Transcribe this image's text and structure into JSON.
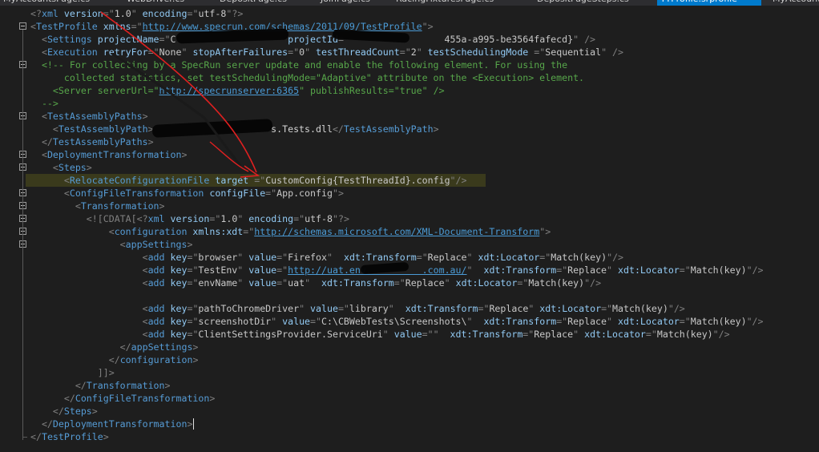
{
  "tabs": [
    {
      "label": "MyAccountsPage.cs",
      "active": false
    },
    {
      "label": "WebDriver.cs",
      "active": false
    },
    {
      "label": "DepositPage.cs",
      "active": false
    },
    {
      "label": "JoinPage.cs",
      "active": false
    },
    {
      "label": "RacingFixturesPage.cs",
      "active": false
    },
    {
      "label": "DepositPageSteps.cs",
      "active": false
    },
    {
      "label": "TTProfile.srprofile",
      "active": true
    },
    {
      "label": "MyAccount",
      "active": false
    }
  ],
  "tab_icons": [
    "pin-icon",
    "close-icon"
  ],
  "code_lines": [
    {
      "indent": 0,
      "parts": [
        [
          "d",
          "<?"
        ],
        [
          "t",
          "xml"
        ],
        [
          "a",
          " version"
        ],
        [
          "d",
          "="
        ],
        [
          "d",
          "\""
        ],
        [
          "v",
          "1.0"
        ],
        [
          "d",
          "\""
        ],
        [
          "a",
          " encoding"
        ],
        [
          "d",
          "="
        ],
        [
          "d",
          "\""
        ],
        [
          "v",
          "utf-8"
        ],
        [
          "d",
          "\""
        ],
        [
          "d",
          "?>"
        ]
      ]
    },
    {
      "indent": 0,
      "parts": [
        [
          "d",
          "<"
        ],
        [
          "t",
          "TestProfile"
        ],
        [
          "a",
          " xmlns"
        ],
        [
          "d",
          "="
        ],
        [
          "d",
          "\""
        ],
        [
          "u",
          "http://www.specrun.com/schemas/2011/09/TestProfile"
        ],
        [
          "d",
          "\""
        ],
        [
          "d",
          ">"
        ]
      ]
    },
    {
      "indent": 1,
      "parts": [
        [
          "d",
          "<"
        ],
        [
          "t",
          "Settings"
        ],
        [
          "a",
          " projectName"
        ],
        [
          "d",
          "="
        ],
        [
          "d",
          "\""
        ],
        [
          "v",
          "C                   "
        ],
        [
          "a",
          " projectId"
        ],
        [
          "d",
          "="
        ],
        [
          "v",
          "                  455a-a995-be3564fafecd}"
        ],
        [
          "d",
          "\""
        ],
        [
          "d",
          " />"
        ]
      ]
    },
    {
      "indent": 1,
      "parts": [
        [
          "d",
          "<"
        ],
        [
          "t",
          "Execution"
        ],
        [
          "a",
          " retryFor"
        ],
        [
          "d",
          "="
        ],
        [
          "d",
          "\""
        ],
        [
          "v",
          "None"
        ],
        [
          "d",
          "\""
        ],
        [
          "a",
          " stopAfterFailures"
        ],
        [
          "d",
          "="
        ],
        [
          "d",
          "\""
        ],
        [
          "v",
          "0"
        ],
        [
          "d",
          "\""
        ],
        [
          "a",
          " testThreadCount"
        ],
        [
          "d",
          "="
        ],
        [
          "d",
          "\""
        ],
        [
          "v",
          "2"
        ],
        [
          "d",
          "\""
        ],
        [
          "a",
          " testSchedulingMode"
        ],
        [
          "d",
          " ="
        ],
        [
          "d",
          "\""
        ],
        [
          "v",
          "Sequential"
        ],
        [
          "d",
          "\""
        ],
        [
          "d",
          " />"
        ]
      ]
    },
    {
      "indent": 1,
      "parts": [
        [
          "c",
          "<!-- For collecting by a SpecRun server update and enable the following element. For using the"
        ]
      ]
    },
    {
      "indent": 0,
      "parts": [
        [
          "c",
          "      collected statistics, set testSchedulingMode=\"Adaptive\" attribute on the <Execution> element."
        ]
      ]
    },
    {
      "indent": 0,
      "parts": [
        [
          "c",
          "    <Server serverUrl=\""
        ],
        [
          "u",
          "http://specrunserver:6365"
        ],
        [
          "c",
          "\" publishResults=\"true\" />"
        ]
      ]
    },
    {
      "indent": 1,
      "parts": [
        [
          "c",
          "-->"
        ]
      ]
    },
    {
      "indent": 1,
      "parts": [
        [
          "d",
          "<"
        ],
        [
          "t",
          "TestAssemblyPaths"
        ],
        [
          "d",
          ">"
        ]
      ]
    },
    {
      "indent": 2,
      "parts": [
        [
          "d",
          "<"
        ],
        [
          "t",
          "TestAssemblyPath"
        ],
        [
          "d",
          ">"
        ],
        [
          "p",
          "           "
        ],
        [
          "p",
          "          s.Tests.dll"
        ],
        [
          "d",
          "</"
        ],
        [
          "t",
          "TestAssemblyPath"
        ],
        [
          "d",
          ">"
        ]
      ]
    },
    {
      "indent": 1,
      "parts": [
        [
          "d",
          "</"
        ],
        [
          "t",
          "TestAssemblyPaths"
        ],
        [
          "d",
          ">"
        ]
      ]
    },
    {
      "indent": 1,
      "parts": [
        [
          "d",
          "<"
        ],
        [
          "t",
          "DeploymentTransformation"
        ],
        [
          "d",
          ">"
        ]
      ]
    },
    {
      "indent": 2,
      "parts": [
        [
          "d",
          "<"
        ],
        [
          "t",
          "Steps"
        ],
        [
          "d",
          ">"
        ]
      ]
    },
    {
      "indent": 3,
      "parts": [
        [
          "d",
          "<"
        ],
        [
          "t",
          "RelocateConfigurationFile"
        ],
        [
          "a",
          " target"
        ],
        [
          "d",
          " ="
        ],
        [
          "d",
          "\""
        ],
        [
          "v",
          "CustomConfig{TestThreadId}.config"
        ],
        [
          "d",
          "\""
        ],
        [
          "d",
          "/>"
        ]
      ]
    },
    {
      "indent": 3,
      "parts": [
        [
          "d",
          "<"
        ],
        [
          "t",
          "ConfigFileTransformation"
        ],
        [
          "a",
          " configFile"
        ],
        [
          "d",
          "="
        ],
        [
          "d",
          "\""
        ],
        [
          "v",
          "App.config"
        ],
        [
          "d",
          "\""
        ],
        [
          "d",
          ">"
        ]
      ]
    },
    {
      "indent": 4,
      "parts": [
        [
          "d",
          "<"
        ],
        [
          "t",
          "Transformation"
        ],
        [
          "d",
          ">"
        ]
      ]
    },
    {
      "indent": 5,
      "parts": [
        [
          "d",
          "<![CDATA["
        ],
        [
          "d",
          "<?"
        ],
        [
          "t",
          "xml"
        ],
        [
          "a",
          " version"
        ],
        [
          "d",
          "="
        ],
        [
          "d",
          "\""
        ],
        [
          "v",
          "1.0"
        ],
        [
          "d",
          "\""
        ],
        [
          "a",
          " encoding"
        ],
        [
          "d",
          "="
        ],
        [
          "d",
          "\""
        ],
        [
          "v",
          "utf-8"
        ],
        [
          "d",
          "\""
        ],
        [
          "d",
          "?>"
        ]
      ]
    },
    {
      "indent": 7,
      "parts": [
        [
          "d",
          "<"
        ],
        [
          "t",
          "configuration"
        ],
        [
          "a",
          " xmlns:xdt"
        ],
        [
          "d",
          "="
        ],
        [
          "d",
          "\""
        ],
        [
          "u",
          "http://schemas.microsoft.com/XML-Document-Transform"
        ],
        [
          "d",
          "\""
        ],
        [
          "d",
          ">"
        ]
      ]
    },
    {
      "indent": 8,
      "parts": [
        [
          "d",
          "<"
        ],
        [
          "t",
          "appSettings"
        ],
        [
          "d",
          ">"
        ]
      ]
    },
    {
      "indent": 10,
      "parts": [
        [
          "d",
          "<"
        ],
        [
          "t",
          "add"
        ],
        [
          "a",
          " key"
        ],
        [
          "d",
          "="
        ],
        [
          "d",
          "\""
        ],
        [
          "v",
          "browser"
        ],
        [
          "d",
          "\""
        ],
        [
          "a",
          " value"
        ],
        [
          "d",
          "="
        ],
        [
          "d",
          "\""
        ],
        [
          "v",
          "Firefox"
        ],
        [
          "d",
          "\""
        ],
        [
          "a",
          "  xdt:Transform"
        ],
        [
          "d",
          "="
        ],
        [
          "d",
          "\""
        ],
        [
          "v",
          "Replace"
        ],
        [
          "d",
          "\""
        ],
        [
          "a",
          " xdt:Locator"
        ],
        [
          "d",
          "="
        ],
        [
          "d",
          "\""
        ],
        [
          "v",
          "Match(key)"
        ],
        [
          "d",
          "\""
        ],
        [
          "d",
          "/>"
        ]
      ]
    },
    {
      "indent": 10,
      "parts": [
        [
          "d",
          "<"
        ],
        [
          "t",
          "add"
        ],
        [
          "a",
          " key"
        ],
        [
          "d",
          "="
        ],
        [
          "d",
          "\""
        ],
        [
          "v",
          "TestEnv"
        ],
        [
          "d",
          "\""
        ],
        [
          "a",
          " value"
        ],
        [
          "d",
          "="
        ],
        [
          "d",
          "\""
        ],
        [
          "u",
          "http://uat.env.         .com.au/"
        ],
        [
          "d",
          "\""
        ],
        [
          "a",
          "  xdt:Transform"
        ],
        [
          "d",
          "="
        ],
        [
          "d",
          "\""
        ],
        [
          "v",
          "Replace"
        ],
        [
          "d",
          "\""
        ],
        [
          "a",
          " xdt:Locator"
        ],
        [
          "d",
          "="
        ],
        [
          "d",
          "\""
        ],
        [
          "v",
          "Match(key)"
        ],
        [
          "d",
          "\""
        ],
        [
          "d",
          "/>"
        ]
      ]
    },
    {
      "indent": 10,
      "parts": [
        [
          "d",
          "<"
        ],
        [
          "t",
          "add"
        ],
        [
          "a",
          " key"
        ],
        [
          "d",
          "="
        ],
        [
          "d",
          "\""
        ],
        [
          "v",
          "envName"
        ],
        [
          "d",
          "\""
        ],
        [
          "a",
          " value"
        ],
        [
          "d",
          "="
        ],
        [
          "d",
          "\""
        ],
        [
          "v",
          "uat"
        ],
        [
          "d",
          "\""
        ],
        [
          "a",
          "  xdt:Transform"
        ],
        [
          "d",
          "="
        ],
        [
          "d",
          "\""
        ],
        [
          "v",
          "Replace"
        ],
        [
          "d",
          "\""
        ],
        [
          "a",
          " xdt:Locator"
        ],
        [
          "d",
          "="
        ],
        [
          "d",
          "\""
        ],
        [
          "v",
          "Match(key)"
        ],
        [
          "d",
          "\""
        ],
        [
          "d",
          "/>"
        ]
      ]
    },
    {
      "indent": 0,
      "parts": []
    },
    {
      "indent": 10,
      "parts": [
        [
          "d",
          "<"
        ],
        [
          "t",
          "add"
        ],
        [
          "a",
          " key"
        ],
        [
          "d",
          "="
        ],
        [
          "d",
          "\""
        ],
        [
          "v",
          "pathToChromeDriver"
        ],
        [
          "d",
          "\""
        ],
        [
          "a",
          " value"
        ],
        [
          "d",
          "="
        ],
        [
          "d",
          "\""
        ],
        [
          "v",
          "library"
        ],
        [
          "d",
          "\""
        ],
        [
          "a",
          "  xdt:Transform"
        ],
        [
          "d",
          "="
        ],
        [
          "d",
          "\""
        ],
        [
          "v",
          "Replace"
        ],
        [
          "d",
          "\""
        ],
        [
          "a",
          " xdt:Locator"
        ],
        [
          "d",
          "="
        ],
        [
          "d",
          "\""
        ],
        [
          "v",
          "Match(key)"
        ],
        [
          "d",
          "\""
        ],
        [
          "d",
          "/>"
        ]
      ]
    },
    {
      "indent": 10,
      "parts": [
        [
          "d",
          "<"
        ],
        [
          "t",
          "add"
        ],
        [
          "a",
          " key"
        ],
        [
          "d",
          "="
        ],
        [
          "d",
          "\""
        ],
        [
          "v",
          "screenshotDir"
        ],
        [
          "d",
          "\""
        ],
        [
          "a",
          " value"
        ],
        [
          "d",
          "="
        ],
        [
          "d",
          "\""
        ],
        [
          "v",
          "C:\\CBWebTests\\Screenshots\\"
        ],
        [
          "d",
          "\""
        ],
        [
          "a",
          "  xdt:Transform"
        ],
        [
          "d",
          "="
        ],
        [
          "d",
          "\""
        ],
        [
          "v",
          "Replace"
        ],
        [
          "d",
          "\""
        ],
        [
          "a",
          " xdt:Locator"
        ],
        [
          "d",
          "="
        ],
        [
          "d",
          "\""
        ],
        [
          "v",
          "Match(key)"
        ],
        [
          "d",
          "\""
        ],
        [
          "d",
          "/>"
        ]
      ]
    },
    {
      "indent": 10,
      "parts": [
        [
          "d",
          "<"
        ],
        [
          "t",
          "add"
        ],
        [
          "a",
          " key"
        ],
        [
          "d",
          "="
        ],
        [
          "d",
          "\""
        ],
        [
          "v",
          "ClientSettingsProvider.ServiceUri"
        ],
        [
          "d",
          "\""
        ],
        [
          "a",
          " value"
        ],
        [
          "d",
          "="
        ],
        [
          "d",
          "\"\""
        ],
        [
          "a",
          "  xdt:Transform"
        ],
        [
          "d",
          "="
        ],
        [
          "d",
          "\""
        ],
        [
          "v",
          "Replace"
        ],
        [
          "d",
          "\""
        ],
        [
          "a",
          " xdt:Locator"
        ],
        [
          "d",
          "="
        ],
        [
          "d",
          "\""
        ],
        [
          "v",
          "Match(key)"
        ],
        [
          "d",
          "\""
        ],
        [
          "d",
          "/>"
        ]
      ]
    },
    {
      "indent": 8,
      "parts": [
        [
          "d",
          "</"
        ],
        [
          "t",
          "appSettings"
        ],
        [
          "d",
          ">"
        ]
      ]
    },
    {
      "indent": 7,
      "parts": [
        [
          "d",
          "</"
        ],
        [
          "t",
          "configuration"
        ],
        [
          "d",
          ">"
        ]
      ]
    },
    {
      "indent": 6,
      "parts": [
        [
          "d",
          "]]>"
        ]
      ]
    },
    {
      "indent": 4,
      "parts": [
        [
          "d",
          "</"
        ],
        [
          "t",
          "Transformation"
        ],
        [
          "d",
          ">"
        ]
      ]
    },
    {
      "indent": 3,
      "parts": [
        [
          "d",
          "</"
        ],
        [
          "t",
          "ConfigFileTransformation"
        ],
        [
          "d",
          ">"
        ]
      ]
    },
    {
      "indent": 2,
      "parts": [
        [
          "d",
          "</"
        ],
        [
          "t",
          "Steps"
        ],
        [
          "d",
          ">"
        ]
      ]
    },
    {
      "indent": 1,
      "parts": [
        [
          "d",
          "</"
        ],
        [
          "t",
          "DeploymentTransformation"
        ],
        [
          "d",
          ">"
        ]
      ]
    },
    {
      "indent": 0,
      "parts": [
        [
          "d",
          "</"
        ],
        [
          "t",
          "TestProfile"
        ],
        [
          "d",
          ">"
        ]
      ]
    }
  ],
  "highlighted_line": 13,
  "cursor_line": 32,
  "colors": {
    "editor_bg": "#1e1e1e",
    "active_tab": "#007acc",
    "tag": "#569cd6",
    "attribute": "#92caf4",
    "comment": "#57a64a",
    "annotation_arrow": "#e02020"
  }
}
